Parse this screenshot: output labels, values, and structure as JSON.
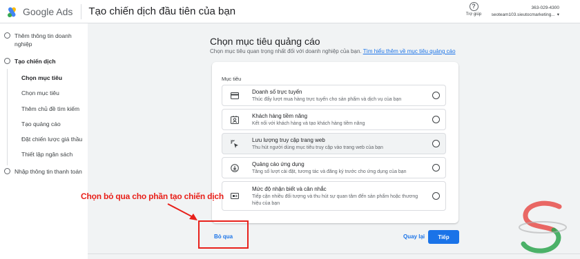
{
  "header": {
    "logo_text": "Google Ads",
    "title": "Tạo chiến dịch đầu tiên của bạn",
    "help_label": "Trợ giúp",
    "account_id": "363-029-4300",
    "account_email": "seoteam103.sieutocmarketing..."
  },
  "sidebar": {
    "step1": "Thêm thông tin doanh nghiệp",
    "step2": "Tạo chiến dịch",
    "substeps": [
      "Chọn mục tiêu",
      "Chọn mục tiêu",
      "Thêm chủ đề tìm kiếm",
      "Tạo quảng cáo",
      "Đặt chiến lược giá thầu",
      "Thiết lập ngân sách"
    ],
    "step3": "Nhập thông tin thanh toán"
  },
  "main": {
    "title": "Chọn mục tiêu quảng cáo",
    "subtitle": "Chọn mục tiêu quan trọng nhất đối với doanh nghiệp của bạn.",
    "learn_more": "Tìm hiểu thêm về mục tiêu quảng cáo",
    "card_label": "Mục tiêu",
    "goals": [
      {
        "title": "Doanh số trực tuyến",
        "desc": "Thúc đẩy lượt mua hàng trực tuyến cho sản phẩm và dịch vụ của bạn",
        "icon": "credit-card-icon"
      },
      {
        "title": "Khách hàng tiềm năng",
        "desc": "Kết nối với khách hàng và tạo khách hàng tiềm năng",
        "icon": "contact-card-icon"
      },
      {
        "title": "Lưu lượng truy cập trang web",
        "desc": "Thu hút người dùng mục tiêu truy cập vào trang web của bạn",
        "icon": "cursor-click-icon"
      },
      {
        "title": "Quảng cáo ứng dụng",
        "desc": "Tăng số lượt cài đặt, tương tác và đăng ký trước cho ứng dụng của bạn",
        "icon": "download-icon"
      },
      {
        "title": "Mức độ nhận biết và cân nhắc",
        "desc": "Tiếp cận nhiều đối tượng và thu hút sự quan tâm đến sản phẩm hoặc thương hiệu của bạn",
        "icon": "screen-icon"
      }
    ],
    "skip_label": "Bỏ qua",
    "back_label": "Quay lại",
    "next_label": "Tiếp"
  },
  "annotation": {
    "text": "Chọn bỏ qua cho phần tạo chiến dịch",
    "color": "#e8201a"
  },
  "colors": {
    "accent": "#1a73e8",
    "background": "#f1f3f4"
  }
}
